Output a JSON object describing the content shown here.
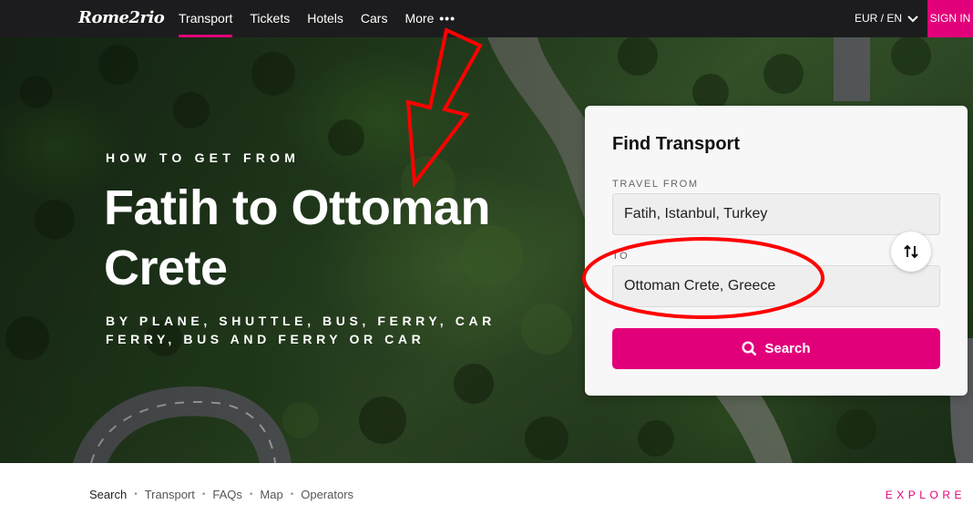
{
  "brand": {
    "logo_text": "Rome2rio",
    "accent": "#e2007a"
  },
  "nav": {
    "links": [
      "Transport",
      "Tickets",
      "Hotels",
      "Cars",
      "More"
    ],
    "active": "Transport",
    "more_dots": "•••",
    "currency_locale": "EUR / EN",
    "signin_label": "SIGN IN"
  },
  "hero": {
    "eyebrow": "HOW TO GET FROM",
    "headline": "Fatih to Ottoman Crete",
    "modes": "BY PLANE, SHUTTLE, BUS, FERRY, CAR FERRY, BUS AND FERRY OR CAR"
  },
  "card": {
    "title": "Find Transport",
    "from_label": "TRAVEL FROM",
    "from_value": "Fatih, Istanbul, Turkey",
    "to_label": "TO",
    "to_value": "Ottoman Crete, Greece",
    "swap_icon": "swap-vertical-icon",
    "search_label": "Search"
  },
  "subnav": {
    "items": [
      "Search",
      "Transport",
      "FAQs",
      "Map",
      "Operators"
    ],
    "separator": "•",
    "explore_label": "EXPLORE"
  },
  "annotations": {
    "color": "#ff0000",
    "arrow": "red-arrow-icon",
    "ellipse": "red-ellipse-icon"
  }
}
